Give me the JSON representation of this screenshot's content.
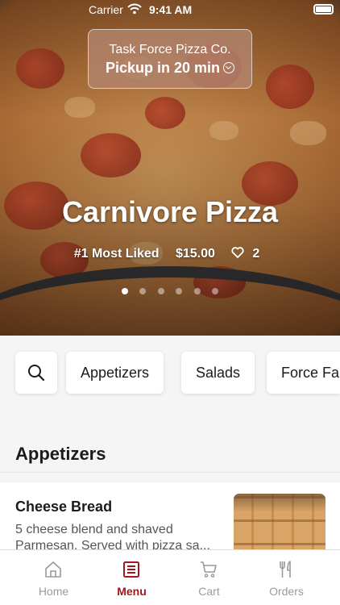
{
  "status_bar": {
    "carrier": "Carrier",
    "time": "9:41 AM"
  },
  "location": {
    "store_name": "Task Force Pizza Co.",
    "pickup_text": "Pickup in 20 min"
  },
  "hero": {
    "title": "Carnivore Pizza",
    "rank": "#1 Most Liked",
    "price": "$15.00",
    "likes": "2",
    "carousel": {
      "total": 6,
      "active_index": 0
    }
  },
  "categories": [
    "Appetizers",
    "Salads",
    "Force Fa"
  ],
  "section": {
    "title": "Appetizers"
  },
  "items": [
    {
      "name": "Cheese Bread",
      "description": "5 cheese blend and shaved Parmesan. Served with pizza sa..."
    }
  ],
  "tabs": [
    {
      "label": "Home",
      "icon": "home-icon",
      "active": false
    },
    {
      "label": "Menu",
      "icon": "menu-icon",
      "active": true
    },
    {
      "label": "Cart",
      "icon": "cart-icon",
      "active": false
    },
    {
      "label": "Orders",
      "icon": "fork-knife-icon",
      "active": false
    }
  ],
  "colors": {
    "accent": "#a3161c",
    "tab_inactive": "#9a9a9a",
    "background": "#f5f5f5"
  }
}
